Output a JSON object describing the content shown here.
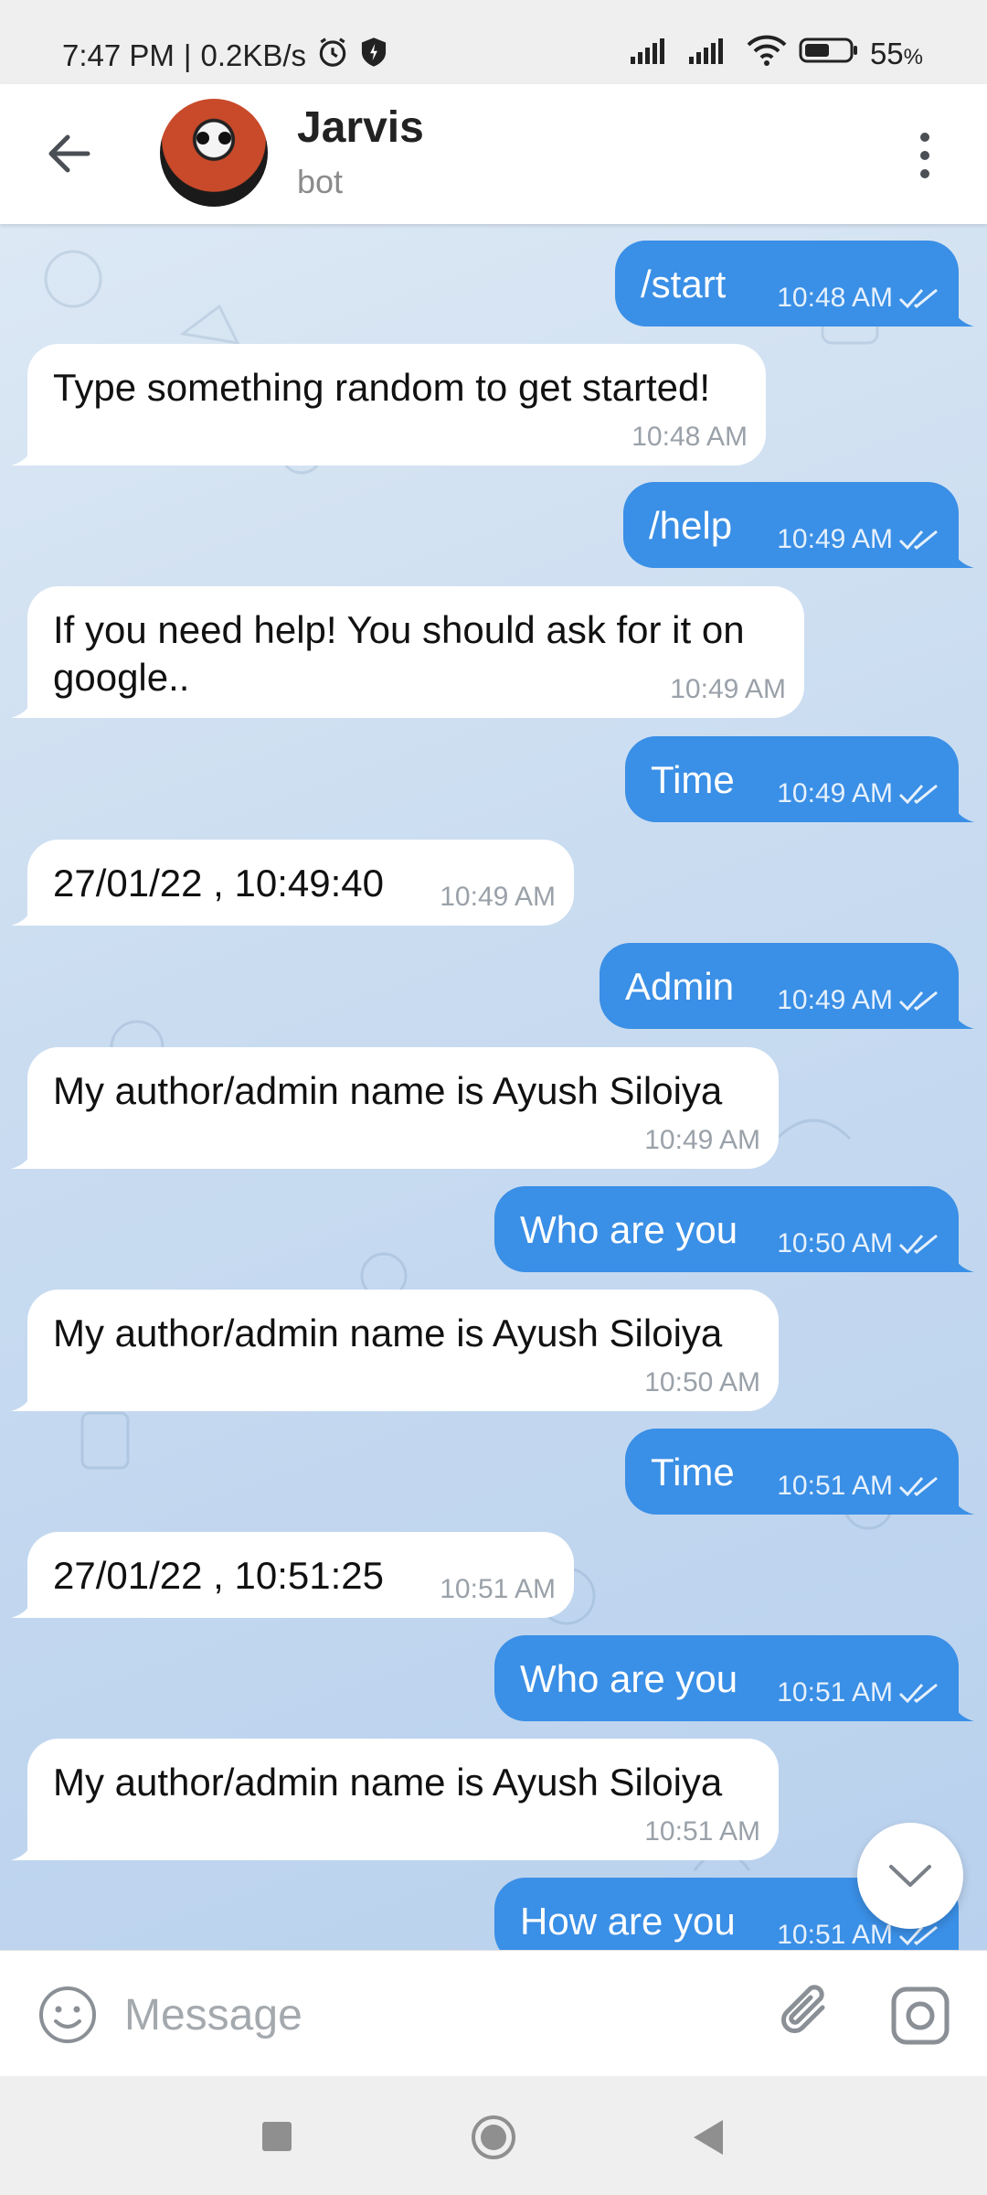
{
  "status_bar": {
    "time": "7:47 PM",
    "speed": "0.2KB/s",
    "battery": "55",
    "battery_unit": "%",
    "icons": [
      "alarm-icon",
      "shield-icon",
      "signal-icon",
      "signal-icon",
      "wifi-icon",
      "battery-icon"
    ]
  },
  "header": {
    "title": "Jarvis",
    "subtitle": "bot",
    "icons": [
      "back-arrow-icon",
      "avatar",
      "more-vertical-icon"
    ]
  },
  "messages": [
    {
      "dir": "out",
      "text": "/start",
      "time": "10:48 AM"
    },
    {
      "dir": "in",
      "text": "Type something random to get started!",
      "time": "10:48 AM"
    },
    {
      "dir": "out",
      "text": "/help",
      "time": "10:49 AM"
    },
    {
      "dir": "in",
      "text": "If you need help! You should ask for it on\ngoogle..",
      "time": "10:49 AM"
    },
    {
      "dir": "out",
      "text": "Time",
      "time": "10:49 AM"
    },
    {
      "dir": "in",
      "text": "27/01/22 , 10:49:40",
      "time": "10:49 AM"
    },
    {
      "dir": "out",
      "text": "Admin",
      "time": "10:49 AM"
    },
    {
      "dir": "in",
      "text": "My author/admin name is Ayush Siloiya",
      "time": "10:49 AM"
    },
    {
      "dir": "out",
      "text": "Who are you",
      "time": "10:50 AM"
    },
    {
      "dir": "in",
      "text": "My author/admin name is Ayush Siloiya",
      "time": "10:50 AM"
    },
    {
      "dir": "out",
      "text": "Time",
      "time": "10:51 AM"
    },
    {
      "dir": "in",
      "text": "27/01/22 , 10:51:25",
      "time": "10:51 AM"
    },
    {
      "dir": "out",
      "text": "Who are you",
      "time": "10:51 AM"
    },
    {
      "dir": "in",
      "text": "My author/admin name is Ayush Siloiya",
      "time": "10:51 AM"
    },
    {
      "dir": "out",
      "text": "How are you",
      "time": "10:51 AM"
    }
  ],
  "input_bar": {
    "placeholder": "Message",
    "icons": [
      "emoji-icon",
      "paperclip-icon",
      "camera-icon"
    ]
  },
  "nav_bar": {
    "icons": [
      "recent-apps-icon",
      "home-icon",
      "back-icon"
    ]
  },
  "colors": {
    "outgoing_bubble": "#3a8fe6",
    "incoming_bubble": "#ffffff",
    "chat_background": "#c8dbf0"
  }
}
